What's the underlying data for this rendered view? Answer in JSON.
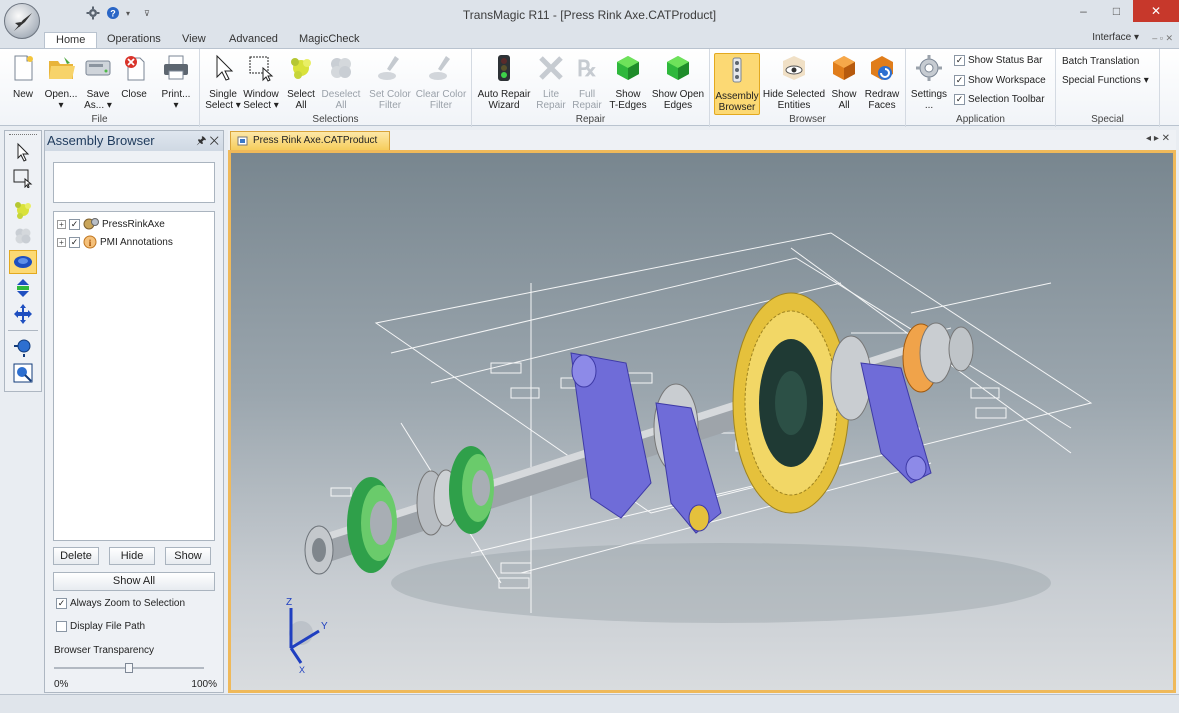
{
  "window": {
    "title": "TransMagic R11 - [Press Rink Axe.CATProduct]",
    "minimize": "–",
    "maximize": "□",
    "close": "✕"
  },
  "ribbon_tabs": [
    "Home",
    "Operations",
    "View",
    "Advanced",
    "MagicCheck"
  ],
  "interface_menu": "Interface ▾",
  "ribbon": {
    "file": {
      "label": "File",
      "new": "New",
      "open": [
        "Open...",
        "▾"
      ],
      "save": [
        "Save",
        "As... ▾"
      ],
      "close": "Close",
      "print": [
        "Print...",
        "▾"
      ]
    },
    "selections": {
      "label": "Selections",
      "single": [
        "Single",
        "Select ▾"
      ],
      "window": [
        "Window",
        "Select ▾"
      ],
      "select_all": [
        "Select",
        "All"
      ],
      "deselect_all": [
        "Deselect",
        "All"
      ],
      "set_color": [
        "Set Color",
        "Filter"
      ],
      "clear_color": [
        "Clear Color",
        "Filter"
      ]
    },
    "repair": {
      "label": "Repair",
      "auto": [
        "Auto Repair",
        "Wizard"
      ],
      "lite": [
        "Lite",
        "Repair"
      ],
      "full": [
        "Full",
        "Repair"
      ],
      "tedges": [
        "Show",
        "T-Edges"
      ],
      "open_edges": [
        "Show Open",
        "Edges"
      ]
    },
    "browser": {
      "label": "Browser",
      "assembly": [
        "Assembly",
        "Browser"
      ],
      "hide_selected": [
        "Hide Selected",
        "Entities"
      ],
      "show_all": [
        "Show",
        "All"
      ],
      "redraw": [
        "Redraw",
        "Faces"
      ]
    },
    "application": {
      "label": "Application",
      "settings": [
        "Settings",
        "..."
      ],
      "status_bar": "Show Status Bar",
      "workspace": "Show Workspace",
      "selection_toolbar": "Selection Toolbar"
    },
    "special": {
      "label": "Special",
      "batch": "Batch Translation",
      "functions": "Special Functions ▾"
    }
  },
  "assembly_browser": {
    "title": "Assembly Browser",
    "tree": [
      {
        "label": "PressRinkAxe",
        "checked": true,
        "icon": "assembly-icon"
      },
      {
        "label": "PMI Annotations",
        "checked": true,
        "icon": "info-icon"
      }
    ],
    "delete": "Delete",
    "hide": "Hide",
    "show": "Show",
    "show_all": "Show All",
    "always_zoom": "Always Zoom to Selection",
    "display_path": "Display File Path",
    "transparency_label": "Browser Transparency",
    "transparency_value": 0.5,
    "min_label": "0%",
    "max_label": "100%"
  },
  "document": {
    "tab": "Press Rink Axe.CATProduct",
    "controls": "◂ ▸ ✕"
  },
  "triad": {
    "x": "X",
    "y": "Y",
    "z": "Z"
  },
  "colors": {
    "gear": "#e5c13c",
    "bracket": "#6f6cd8",
    "green_ring": "#2fae4a",
    "steel": "#c9cdd1",
    "highlight": "#efb95a"
  }
}
